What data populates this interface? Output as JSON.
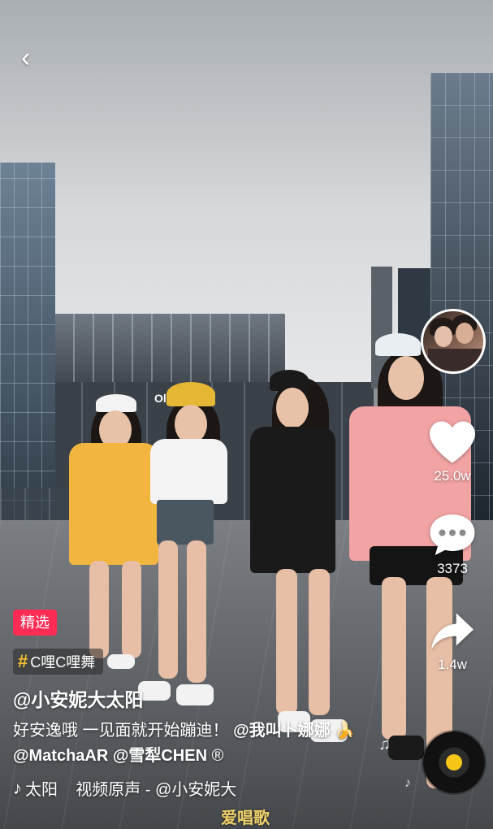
{
  "player": {
    "author_handle": "@小安妮大太阳",
    "badge_featured": "精选",
    "topic": {
      "hash": "#",
      "label": "C哩C哩舞"
    },
    "description": {
      "text": "好安逸哦 一见面就开始蹦迪！",
      "mention1": "@我叫卜娜娜",
      "emoji": "🍌",
      "mention2": "@MatchaAR",
      "mention3": "@雪犁CHEN",
      "mark": "®"
    },
    "music": {
      "note_icon": "tiktok-note-icon",
      "text": "太阳    视频原声 - @小安妮大"
    },
    "likes": "25.0w",
    "comments": "3373",
    "shares": "1.4w"
  },
  "overlay": {
    "back_glyph": "‹",
    "watermark": "爱唱歌",
    "scene_sign": "Ol"
  },
  "colors": {
    "featured_bg": "#fe2c55",
    "topic_hash": "#f6c12e",
    "disc_center": "#f5c518"
  }
}
